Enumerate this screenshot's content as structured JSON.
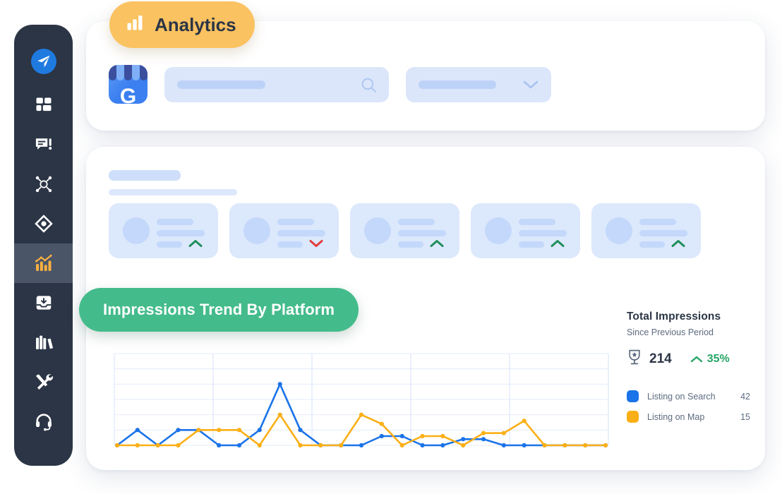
{
  "sidebar": {
    "logo": {
      "icon": "paper-plane-icon",
      "color": "#1f7ae0"
    },
    "items": [
      {
        "name": "dashboard",
        "icon": "grid-dashboard-icon",
        "active": false
      },
      {
        "name": "messages",
        "icon": "message-alert-icon",
        "active": false
      },
      {
        "name": "network",
        "icon": "network-nodes-icon",
        "active": false
      },
      {
        "name": "compass",
        "icon": "diamond-compass-icon",
        "active": false
      },
      {
        "name": "analytics",
        "icon": "bar-chart-trend-icon",
        "active": true
      },
      {
        "name": "inbox",
        "icon": "inbox-download-icon",
        "active": false
      },
      {
        "name": "library",
        "icon": "books-library-icon",
        "active": false
      },
      {
        "name": "tools",
        "icon": "wrench-screwdriver-icon",
        "active": false
      },
      {
        "name": "support",
        "icon": "headset-icon",
        "active": false
      }
    ],
    "active_color": "#fbb040"
  },
  "badge": {
    "label": "Analytics",
    "icon": "bar-chart-icon",
    "bg": "#fbc261",
    "text_color": "#2b3545"
  },
  "topbar": {
    "profile_icon": "google-business-profile-icon",
    "profile_letter": "G",
    "search": {
      "placeholder": "",
      "value": "",
      "icon": "search-icon"
    },
    "filter": {
      "value": "",
      "icon": "chevron-down-icon"
    }
  },
  "main": {
    "title_placeholder": "",
    "subtitle_placeholder": "",
    "kpi_cards": [
      {
        "trend": "up",
        "icon": "chevron-up-icon",
        "color": "#1e8e5a"
      },
      {
        "trend": "down",
        "icon": "chevron-down-icon",
        "color": "#e23d3d"
      },
      {
        "trend": "up",
        "icon": "chevron-up-icon",
        "color": "#1e8e5a"
      },
      {
        "trend": "up",
        "icon": "chevron-up-icon",
        "color": "#1e8e5a"
      },
      {
        "trend": "up",
        "icon": "chevron-up-icon",
        "color": "#1e8e5a"
      }
    ],
    "section_pill": {
      "label": "Impressions Trend By Platform",
      "bg": "#44bb8b",
      "text_color": "#ffffff"
    },
    "stats": {
      "title": "Total Impressions",
      "subtitle": "Since Previous Period",
      "icon": "trophy-award-icon",
      "value": "214",
      "delta": "35%",
      "delta_icon": "chevron-up-icon",
      "delta_color": "#27a567"
    }
  },
  "chart_data": {
    "type": "line",
    "title": "Impressions Trend By Platform",
    "xlabel": "",
    "ylabel": "",
    "grid": true,
    "legend_position": "right",
    "ylim": [
      0,
      30
    ],
    "x": [
      1,
      2,
      3,
      4,
      5,
      6,
      7,
      8,
      9,
      10,
      11,
      12,
      13,
      14,
      15,
      16,
      17,
      18,
      19,
      20,
      21,
      22,
      23,
      24,
      25
    ],
    "series": [
      {
        "name": "Listing on Search",
        "color": "#1a73e8",
        "total": 42,
        "values": [
          0,
          5,
          0,
          5,
          5,
          0,
          0,
          5,
          20,
          5,
          0,
          0,
          0,
          3,
          3,
          0,
          0,
          2,
          2,
          0,
          0,
          0,
          0,
          0,
          0
        ]
      },
      {
        "name": "Listing on Map",
        "color": "#fbaf17",
        "total": 15,
        "values": [
          0,
          0,
          0,
          0,
          5,
          5,
          5,
          0,
          10,
          0,
          0,
          0,
          10,
          7,
          0,
          3,
          3,
          0,
          4,
          4,
          8,
          0,
          0,
          0,
          0
        ]
      }
    ],
    "legend": [
      {
        "label": "Listing on Search",
        "value": "42",
        "color": "#1a73e8"
      },
      {
        "label": "Listing on Map",
        "value": "15",
        "color": "#fbaf17"
      }
    ]
  }
}
